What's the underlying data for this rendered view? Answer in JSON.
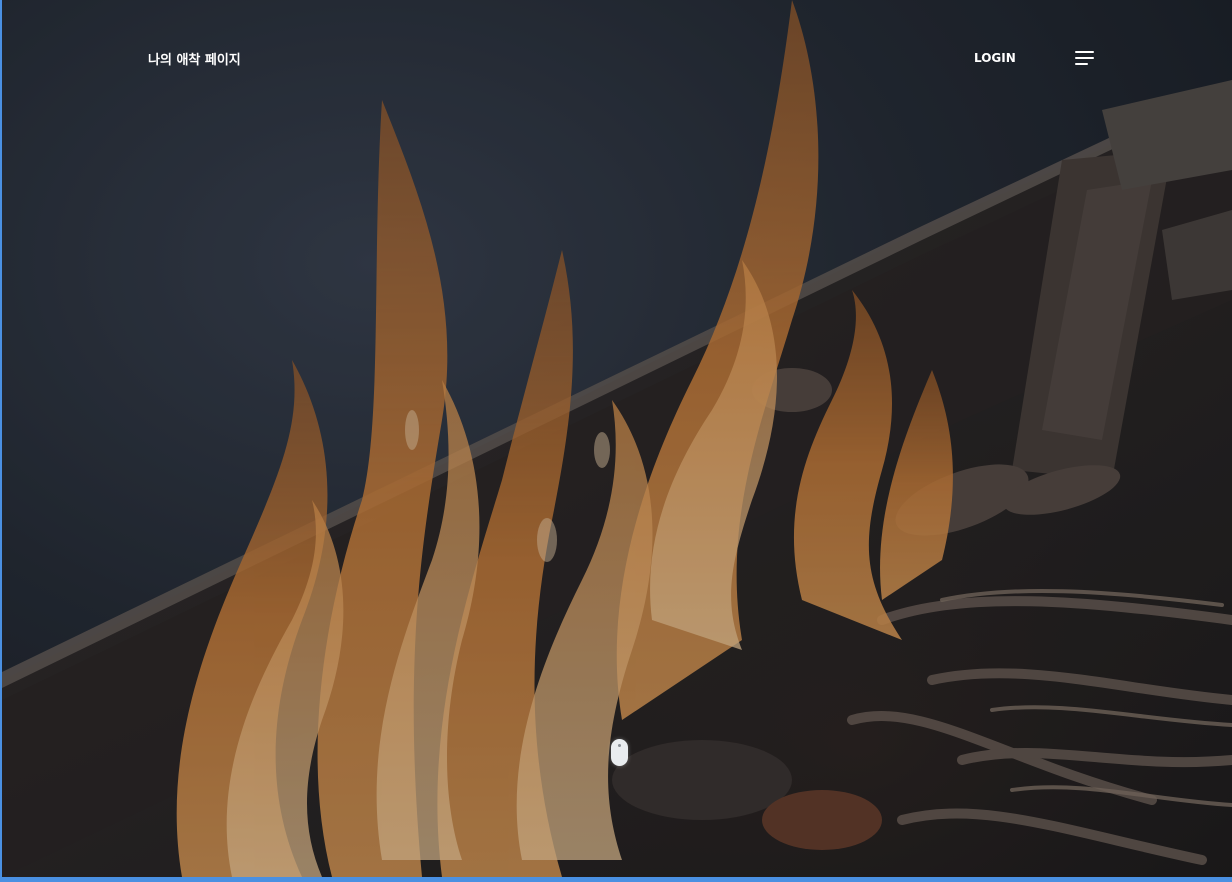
{
  "header": {
    "brand_title": "나의 애착 페이지",
    "login_label": "LOGIN",
    "menu_icon": "hamburger-menu-icon"
  },
  "hero": {
    "image_subject": "campfire-flames-on-logs",
    "scroll_icon": "mouse-scroll-icon"
  },
  "colors": {
    "frame_accent": "#4a90e2",
    "header_text": "#ffffff",
    "flame_orange": "#e08a3c"
  }
}
